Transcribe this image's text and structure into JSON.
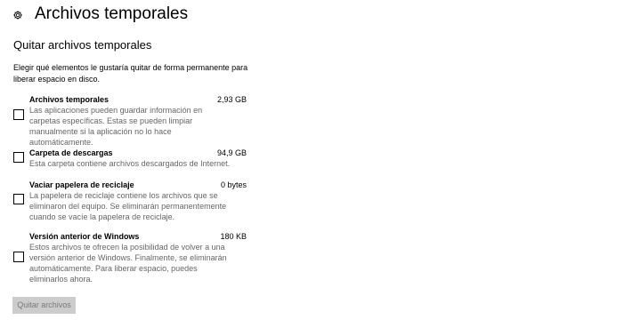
{
  "page": {
    "title": "Archivos temporales",
    "icon": "gear-icon"
  },
  "section": {
    "title": "Quitar archivos temporales",
    "description": "Elegir qué elementos le gustaría quitar de forma permanente para liberar espacio en disco."
  },
  "items": [
    {
      "title": "Archivos temporales",
      "size": "2,93 GB",
      "description": "Las aplicaciones pueden guardar información en carpetas específicas. Estas se pueden limpiar manualmente si la aplicación no lo hace automáticamente.",
      "checked": false
    },
    {
      "title": "Carpeta de descargas",
      "size": "94,9 GB",
      "description": "Esta carpeta contiene archivos descargados de Internet.",
      "checked": false
    },
    {
      "title": "Vaciar papelera de reciclaje",
      "size": "0 bytes",
      "description": "La papelera de reciclaje contiene los archivos que se eliminaron del equipo. Se eliminarán permanentemente cuando se vacíe la papelera de reciclaje.",
      "checked": false
    },
    {
      "title": "Versión anterior de Windows",
      "size": "180 KB",
      "description": "Estos archivos te ofrecen la posibilidad de volver a una versión anterior de Windows. Finalmente, se eliminarán automáticamente. Para liberar espacio, puedes eliminarlos ahora.",
      "checked": false
    }
  ],
  "actions": {
    "remove_label": "Quitar archivos",
    "remove_enabled": false
  }
}
